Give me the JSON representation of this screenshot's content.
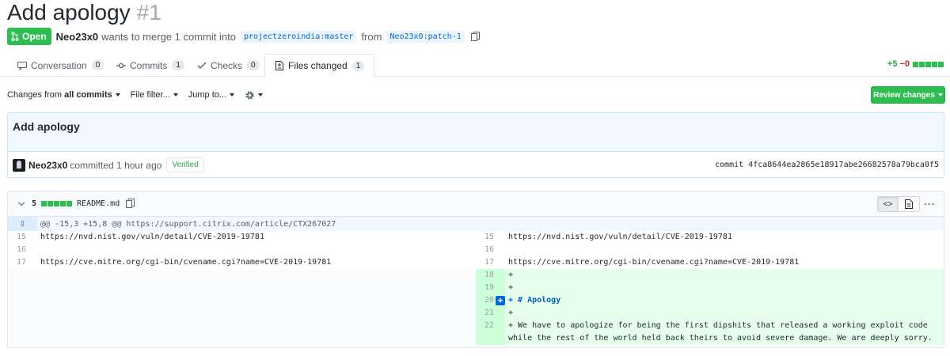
{
  "pr": {
    "title": "Add apology",
    "number": "#1",
    "state": "Open",
    "author": "Neo23x0",
    "merge_text_1": "wants to merge 1 commit into",
    "base_branch": "projectzeroindia:master",
    "from_text": "from",
    "head_branch": "Neo23x0:patch-1"
  },
  "tabs": [
    {
      "label": "Conversation",
      "count": "0"
    },
    {
      "label": "Commits",
      "count": "1"
    },
    {
      "label": "Checks",
      "count": "0"
    },
    {
      "label": "Files changed",
      "count": "1"
    }
  ],
  "diffstat": {
    "additions": "+5",
    "deletions": "−0"
  },
  "toolbar": {
    "changes_prefix": "Changes from",
    "changes_value": "all commits",
    "file_filter": "File filter...",
    "jump_to": "Jump to..."
  },
  "review_button": "Review changes",
  "commit": {
    "message": "Add apology",
    "author": "Neo23x0",
    "time_text": "committed 1 hour ago",
    "verified": "Verified",
    "sha_label": "commit",
    "sha": "4fca8644ea2865e18917abe26682578a79bca0f5"
  },
  "file": {
    "change_count": "5",
    "name": "README.md"
  },
  "hunk": {
    "gutter": "⇳",
    "header": "@@ -15,3 +15,8 @@ https://support.citrix.com/article/CTX267027"
  },
  "left_lines": [
    {
      "num": "15",
      "text": "https://nvd.nist.gov/vuln/detail/CVE-2019-19781"
    },
    {
      "num": "16",
      "text": ""
    },
    {
      "num": "17",
      "text": "https://cve.mitre.org/cgi-bin/cvename.cgi?name=CVE-2019-19781"
    }
  ],
  "right_lines": [
    {
      "num": "15",
      "text": "https://nvd.nist.gov/vuln/detail/CVE-2019-19781"
    },
    {
      "num": "16",
      "text": ""
    },
    {
      "num": "17",
      "text": "https://cve.mitre.org/cgi-bin/cvename.cgi?name=CVE-2019-19781"
    }
  ],
  "added_lines": [
    {
      "num": "18",
      "text": "+"
    },
    {
      "num": "19",
      "text": "+"
    },
    {
      "num": "20",
      "text": "+ # Apology"
    },
    {
      "num": "21",
      "text": "+"
    },
    {
      "num": "22",
      "text": "+ We have to apologize for being the first dipshits that released a working exploit code while the rest of the world held back theirs to avoid severe damage. We are deeply sorry."
    }
  ],
  "colors": {
    "open_green": "#2cbe4e",
    "link_blue": "#0366d6",
    "addition_bg": "#e6ffed",
    "addition_gutter": "#cdffd8",
    "hunk_bg": "#f1f8ff"
  },
  "icons": [
    "pull-request-icon",
    "copy-icon",
    "conversation-icon",
    "commits-icon",
    "checks-icon",
    "file-diff-icon",
    "gear-icon",
    "chevron-down-icon",
    "code-view-icon",
    "rich-diff-icon",
    "kebab-icon",
    "expand-icon",
    "add-comment-icon"
  ]
}
